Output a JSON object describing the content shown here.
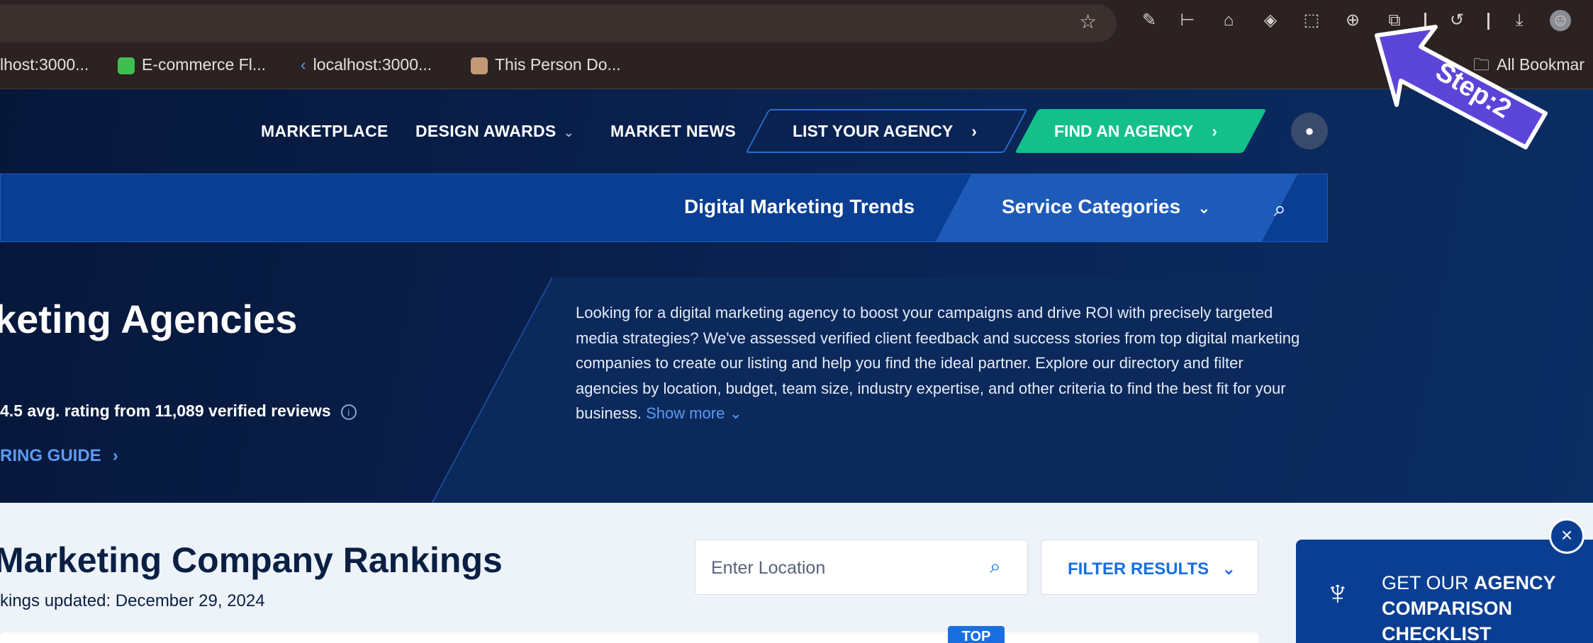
{
  "browser": {
    "bookmarks": [
      {
        "label": "lhost:3000..."
      },
      {
        "label": "E-commerce Fl..."
      },
      {
        "label": "localhost:3000..."
      },
      {
        "label": "This Person Do..."
      },
      {
        "label": "All Bookmar"
      }
    ]
  },
  "nav": {
    "marketplace": "MARKETPLACE",
    "design_awards": "DESIGN AWARDS",
    "market_news": "MARKET NEWS",
    "list_agency": "LIST YOUR AGENCY",
    "find_agency": "FIND AN AGENCY"
  },
  "subnav": {
    "trends": "Digital Marketing Trends",
    "categories": "Service Categories"
  },
  "hero": {
    "title": "keting Agencies",
    "rating": "4.5 avg. rating from 11,089 verified reviews",
    "guide": "RING GUIDE",
    "description": "Looking for a digital marketing agency to boost your campaigns and drive ROI with precisely targeted media strategies? We've assessed verified client feedback and success stories from top digital marketing companies to create our listing and help you find the ideal partner. Explore our directory and filter agencies by location, budget, team size, industry expertise, and other criteria to find the best fit for your business.",
    "show_more": "Show more"
  },
  "rankings": {
    "title": "Marketing Company Rankings",
    "updated": "kings updated: December 29, 2024",
    "location_placeholder": "Enter Location",
    "filter_label": "FILTER RESULTS",
    "top_badge": "TOP"
  },
  "promo": {
    "line1": "GET OUR",
    "line1_bold": "AGENCY",
    "line2": "COMPARISON",
    "line3": "CHECKLIST"
  },
  "annotation": {
    "step": "Step:2"
  },
  "colors": {
    "brand_dark": "#061b3f",
    "brand_blue": "#0a3e93",
    "accent_green": "#13c08a",
    "link_blue": "#5b9bf5",
    "annotation_purple": "#5b45d8"
  }
}
